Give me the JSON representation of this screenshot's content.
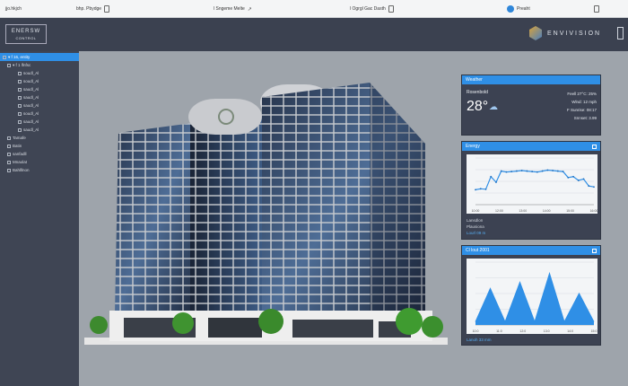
{
  "toolbar": {
    "items": [
      {
        "label": "jjo.hkjch",
        "icon": "none"
      },
      {
        "label": "bhp. Pbydge",
        "icon": "page-icon"
      },
      {
        "label": "l Sngeme Melte",
        "icon": "arrow-icon"
      },
      {
        "label": "l Ogrgl Gac Dasth",
        "icon": "page-icon"
      },
      {
        "label": "Preaht",
        "icon": "blue-dot-icon"
      },
      {
        "label": "",
        "icon": "lock-icon"
      }
    ]
  },
  "header": {
    "logo_left_line1": "ENERSW",
    "logo_left_line2": "CONTROL",
    "brand": "ENVIVISION"
  },
  "sidebar": {
    "items": [
      {
        "label": "▾ f 16, entity",
        "level": 0,
        "selected": true
      },
      {
        "label": "▾ f 1 lfnfsc",
        "level": 1
      },
      {
        "label": "soudl_Al",
        "level": 2
      },
      {
        "label": "soudl_Al",
        "level": 2
      },
      {
        "label": "saudl_Al",
        "level": 2
      },
      {
        "label": "saudl_Al",
        "level": 2
      },
      {
        "label": "saudl_Al",
        "level": 2
      },
      {
        "label": "soudl_Al",
        "level": 2
      },
      {
        "label": "saudl_Al",
        "level": 2
      },
      {
        "label": "saudl_Al",
        "level": 2
      },
      {
        "label": "Tamafe",
        "level": 1
      },
      {
        "label": "Batin",
        "level": 1
      },
      {
        "label": "sanfadll",
        "level": 1
      },
      {
        "label": "Mnaolat",
        "level": 1
      },
      {
        "label": "Bahlllnon",
        "level": 1
      }
    ]
  },
  "weather": {
    "title": "Weather",
    "city": "Rosenbold",
    "temp": "28°",
    "details": [
      "Feell 27°C: 25%",
      "Wlnd: 12 mph",
      "F Sunrise: 08:17",
      "Snnset: 3.99"
    ]
  },
  "chart1": {
    "title": "Energy",
    "footer_label": "Lansdlon",
    "footer_value": "Plausiona",
    "footer_link": "Lourl 09 m"
  },
  "chart2": {
    "title": "Cl lout 2001",
    "footer_link": "Lanoh 33 mm"
  },
  "chart_data": [
    {
      "type": "line",
      "title": "",
      "series": [
        {
          "values": [
            32,
            34,
            33,
            60,
            48,
            72,
            70,
            71,
            72,
            73,
            72,
            71,
            70,
            72,
            74,
            73,
            72,
            71,
            58,
            60,
            52,
            55,
            40,
            38
          ]
        }
      ],
      "ylim": [
        0,
        100
      ],
      "x_ticks": [
        "10:00",
        "12:00",
        "13:00",
        "14:00",
        "15:00",
        "16:00"
      ]
    },
    {
      "type": "area",
      "title": "",
      "series": [
        {
          "values": [
            5,
            58,
            5,
            68,
            5,
            82,
            5,
            50,
            5
          ]
        }
      ],
      "ylim": [
        0,
        100
      ],
      "x_ticks": [
        "10:0",
        "11:0",
        "12:0",
        "13:0",
        "14:0",
        "15:0"
      ]
    }
  ]
}
